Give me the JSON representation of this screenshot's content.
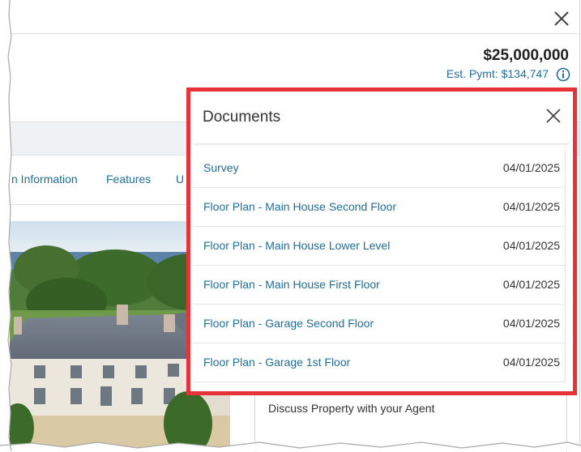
{
  "header": {
    "price": "$25,000,000",
    "est_payment": "Est. Pymt: $134,747"
  },
  "tabs": [
    {
      "label": "n Information"
    },
    {
      "label": "Features"
    },
    {
      "label": "U"
    }
  ],
  "documents_panel": {
    "title": "Documents",
    "items": [
      {
        "name": "Survey",
        "date": "04/01/2025"
      },
      {
        "name": "Floor Plan - Main House Second Floor",
        "date": "04/01/2025"
      },
      {
        "name": "Floor Plan - Main House Lower Level",
        "date": "04/01/2025"
      },
      {
        "name": "Floor Plan - Main House First Floor",
        "date": "04/01/2025"
      },
      {
        "name": "Floor Plan - Garage Second Floor",
        "date": "04/01/2025"
      },
      {
        "name": "Floor Plan - Garage 1st Floor",
        "date": "04/01/2025"
      }
    ]
  },
  "agent": {
    "label": "Discuss Property with your Agent"
  },
  "colors": {
    "link": "#1f6e99",
    "highlight_border": "#e8323a"
  }
}
